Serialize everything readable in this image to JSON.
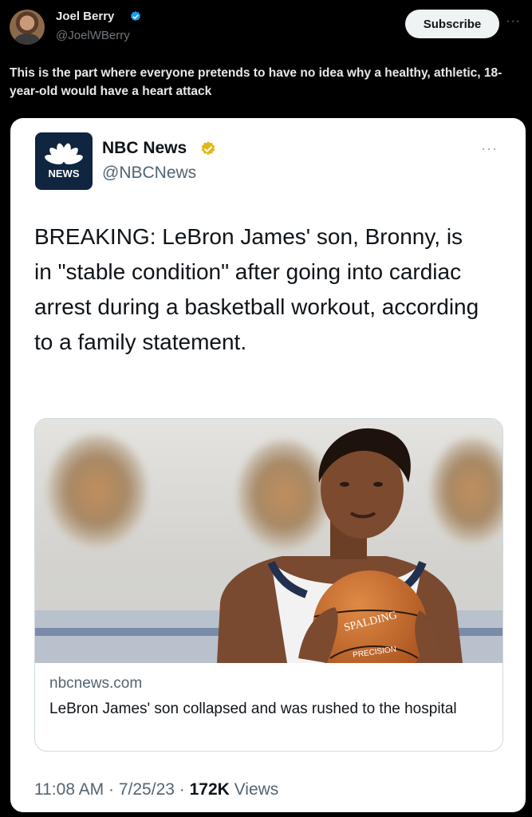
{
  "outer_post": {
    "author_name": "Joel Berry",
    "author_handle": "@JoelWBerry",
    "subscribe_label": "Subscribe",
    "more_label": "···",
    "text": "This is the part where everyone pretends to have no idea why a healthy, athletic, 18-year-old would have a heart attack"
  },
  "quoted_post": {
    "logo_text": "NEWS",
    "author_name": "NBC News",
    "author_handle": "@NBCNews",
    "more_label": "···",
    "text": "BREAKING: LeBron James' son, Bronny, is in \"stable condition\" after going into cardiac arrest during a basketball workout, according to a family statement.",
    "link_card": {
      "domain": "nbcnews.com",
      "title": "LeBron James' son collapsed and was rushed to the hospital",
      "ball_text_1": "SPALDING",
      "ball_text_2": "PRECISION"
    },
    "meta": {
      "time": "11:08 AM",
      "separator": "·",
      "date": "7/25/23",
      "views_count": "172K",
      "views_label": "Views"
    }
  },
  "colors": {
    "background": "#000000",
    "card": "#ffffff",
    "verified_blue": "#1d9bf0",
    "verified_gold": "#e2b719",
    "muted": "#536471"
  }
}
